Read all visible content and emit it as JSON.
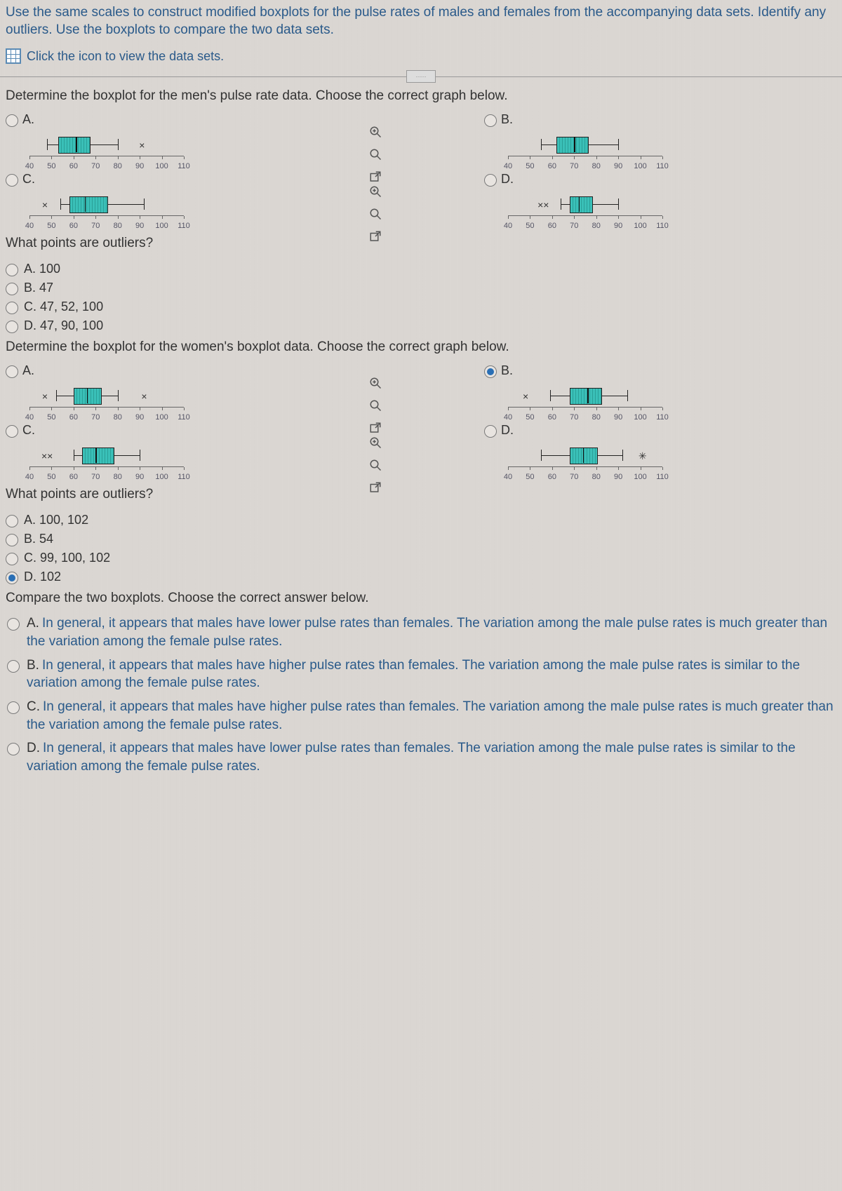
{
  "instructions": "Use the same scales to construct modified boxplots for the pulse rates of males and females from the accompanying data sets. Identify any outliers. Use the boxplots to compare the two data sets.",
  "icon_link": "Click the icon to view the data sets.",
  "q1": {
    "text": "Determine the boxplot for the men's pulse rate data. Choose the correct graph below.",
    "labels": {
      "A": "A.",
      "B": "B.",
      "C": "C.",
      "D": "D."
    },
    "ticks": [
      "40",
      "50",
      "60",
      "70",
      "80",
      "90",
      "100",
      "110"
    ]
  },
  "outliers1": {
    "text": "What points are outliers?",
    "choices": {
      "A": "A.   100",
      "B": "B.   47",
      "C": "C.   47, 52, 100",
      "D": "D.   47, 90, 100"
    }
  },
  "q2": {
    "text": "Determine the boxplot for the women's boxplot data. Choose the correct graph below.",
    "labels": {
      "A": "A.",
      "B": "B.",
      "C": "C.",
      "D": "D."
    },
    "ticks": [
      "40",
      "50",
      "60",
      "70",
      "80",
      "90",
      "100",
      "110"
    ]
  },
  "outliers2": {
    "text": "What points are outliers?",
    "choices": {
      "A": "A.   100, 102",
      "B": "B.   54",
      "C": "C.   99, 100, 102",
      "D": "D.   102"
    }
  },
  "compare": {
    "text": "Compare the two boxplots. Choose the correct answer below.",
    "A": "In general, it appears that males have lower pulse rates than females. The variation among the male pulse rates is much greater than the variation among the female pulse rates.",
    "B": "In general, it appears that males have higher pulse rates than females. The variation among the male pulse rates is similar to the variation among the female pulse rates.",
    "C": "In general, it appears that males have higher pulse rates than females. The variation among the male pulse rates is much greater than the variation among the female pulse rates.",
    "D": "In general, it appears that males have lower pulse rates than females. The variation among the male pulse rates is similar to the variation among the female pulse rates.",
    "letters": {
      "A": "A.",
      "B": "B.",
      "C": "C.",
      "D": "D."
    }
  },
  "chart_data": [
    {
      "type": "boxplot",
      "id": "men-A",
      "axis": [
        40,
        110
      ],
      "min": 48,
      "q1": 53,
      "median": 61,
      "q3": 67,
      "max": 80,
      "outliers": [
        91
      ],
      "outlier_sym": "×"
    },
    {
      "type": "boxplot",
      "id": "men-B",
      "axis": [
        40,
        110
      ],
      "min": 55,
      "q1": 62,
      "median": 70,
      "q3": 76,
      "max": 90,
      "outliers": []
    },
    {
      "type": "boxplot",
      "id": "men-C",
      "axis": [
        40,
        110
      ],
      "min": 54,
      "q1": 58,
      "median": 65,
      "q3": 75,
      "max": 92,
      "outliers": [
        47
      ],
      "outlier_sym": "×"
    },
    {
      "type": "boxplot",
      "id": "men-D",
      "axis": [
        40,
        110
      ],
      "min": 64,
      "q1": 68,
      "median": 72,
      "q3": 78,
      "max": 90,
      "outliers": [
        56,
        60
      ],
      "outlier_sym": "××"
    },
    {
      "type": "boxplot",
      "id": "women-A",
      "axis": [
        40,
        110
      ],
      "min": 52,
      "q1": 60,
      "median": 66,
      "q3": 72,
      "max": 80,
      "outliers": [
        47,
        92
      ],
      "outlier_sym": "×"
    },
    {
      "type": "boxplot",
      "id": "women-B",
      "axis": [
        40,
        110
      ],
      "min": 59,
      "q1": 68,
      "median": 76,
      "q3": 82,
      "max": 94,
      "outliers": [
        48
      ],
      "outlier_sym": "×"
    },
    {
      "type": "boxplot",
      "id": "women-C",
      "axis": [
        40,
        110
      ],
      "min": 60,
      "q1": 64,
      "median": 70,
      "q3": 78,
      "max": 90,
      "outliers": [
        48,
        52
      ],
      "outlier_sym": "××"
    },
    {
      "type": "boxplot",
      "id": "women-D",
      "axis": [
        40,
        110
      ],
      "min": 55,
      "q1": 68,
      "median": 74,
      "q3": 80,
      "max": 92,
      "outliers": [
        101
      ],
      "outlier_sym": "✳"
    }
  ]
}
